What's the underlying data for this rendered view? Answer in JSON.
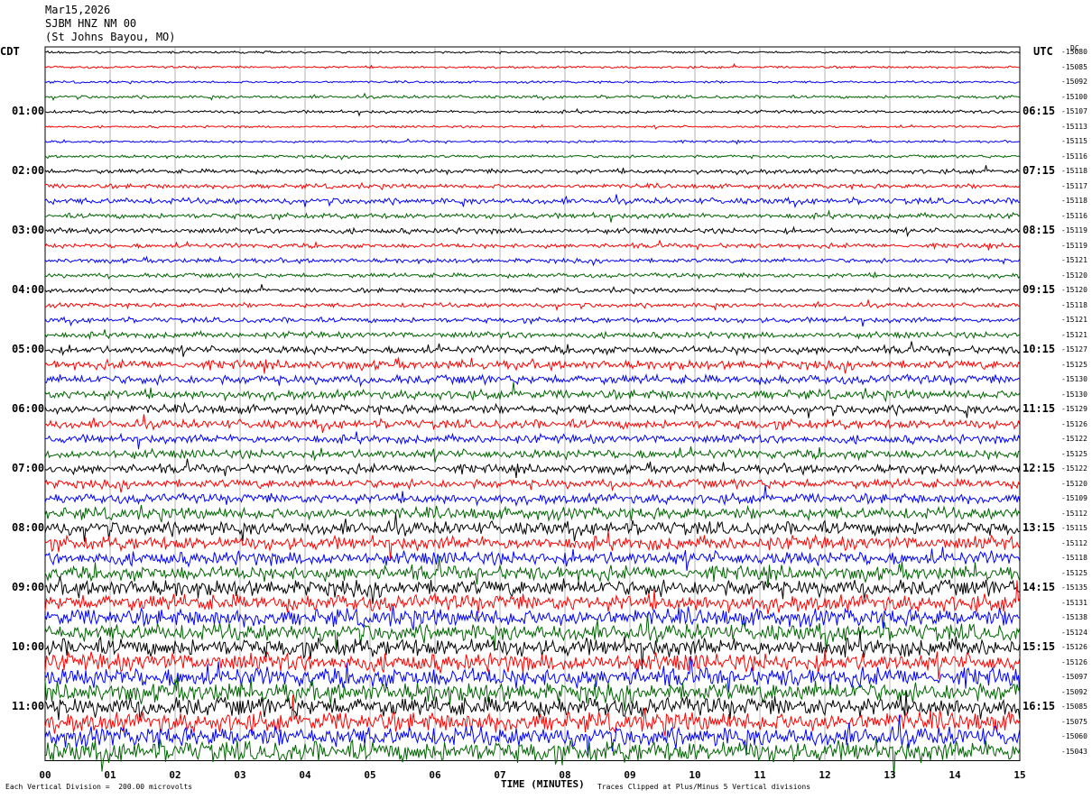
{
  "header": {
    "date": "Mar15,2026",
    "station": "SJBM HNZ NM 00",
    "location": "(St Johns Bayou, MO)"
  },
  "left_zone": "CDT",
  "right_zone": "UTC",
  "dc_label": "DC",
  "footer": {
    "left": "Each Vertical Division =  200.00 microvolts",
    "center": "TIME (MINUTES)",
    "right": "Traces Clipped at Plus/Minus 5 Vertical divisions"
  },
  "colors": {
    "trace_cycle": [
      "#000000",
      "#ff0000",
      "#0000ff",
      "#006400"
    ],
    "grid": "#808080"
  },
  "chart_data": {
    "type": "line",
    "title": "SJBM HNZ NM 00 (St Johns Bayou, MO)",
    "xlabel": "TIME (MINUTES)",
    "xlim": [
      0,
      15
    ],
    "x_ticks": [
      "00",
      "01",
      "02",
      "03",
      "04",
      "05",
      "06",
      "07",
      "08",
      "09",
      "10",
      "11",
      "12",
      "13",
      "14",
      "15"
    ],
    "left_time_labels": [
      {
        "row": 4,
        "label": "01:00"
      },
      {
        "row": 8,
        "label": "02:00"
      },
      {
        "row": 12,
        "label": "03:00"
      },
      {
        "row": 16,
        "label": "04:00"
      },
      {
        "row": 20,
        "label": "05:00"
      },
      {
        "row": 24,
        "label": "06:00"
      },
      {
        "row": 28,
        "label": "07:00"
      },
      {
        "row": 32,
        "label": "08:00"
      },
      {
        "row": 36,
        "label": "09:00"
      },
      {
        "row": 40,
        "label": "10:00"
      },
      {
        "row": 44,
        "label": "11:00"
      }
    ],
    "right_time_labels": [
      {
        "row": 4,
        "label": "06:15"
      },
      {
        "row": 8,
        "label": "07:15"
      },
      {
        "row": 12,
        "label": "08:15"
      },
      {
        "row": 16,
        "label": "09:15"
      },
      {
        "row": 20,
        "label": "10:15"
      },
      {
        "row": 24,
        "label": "11:15"
      },
      {
        "row": 28,
        "label": "12:15"
      },
      {
        "row": 32,
        "label": "13:15"
      },
      {
        "row": 36,
        "label": "14:15"
      },
      {
        "row": 40,
        "label": "15:15"
      },
      {
        "row": 44,
        "label": "16:15"
      }
    ],
    "dc_offsets": [
      "-15080",
      "-15085",
      "-15092",
      "-15100",
      "-15107",
      "-15113",
      "-15115",
      "-15116",
      "-15118",
      "-15117",
      "-15118",
      "-15116",
      "-15119",
      "-15119",
      "-15121",
      "-15120",
      "-15120",
      "-15118",
      "-15121",
      "-15121",
      "-15127",
      "-15125",
      "-15130",
      "-15130",
      "-15129",
      "-15126",
      "-15122",
      "-15125",
      "-15122",
      "-15120",
      "-15109",
      "-15112",
      "-15115",
      "-15112",
      "-15118",
      "-15125",
      "-15135",
      "-15131",
      "-15138",
      "-15124",
      "-15126",
      "-15126",
      "-15097",
      "-15092",
      "-15085",
      "-15075",
      "-15060",
      "-15043"
    ],
    "trace_amplitude": [
      1.5,
      1.5,
      1.5,
      2,
      2,
      1.5,
      1.5,
      2,
      3,
      3,
      4,
      3.5,
      3.5,
      3,
      3,
      3,
      3,
      3,
      3.5,
      4,
      5,
      6,
      6,
      6,
      6,
      6,
      5.5,
      6,
      6,
      6,
      6.5,
      8,
      9,
      9,
      9,
      9.5,
      11,
      11,
      11.5,
      11.5,
      12,
      12,
      12.5,
      13,
      13,
      13,
      13,
      14
    ]
  }
}
